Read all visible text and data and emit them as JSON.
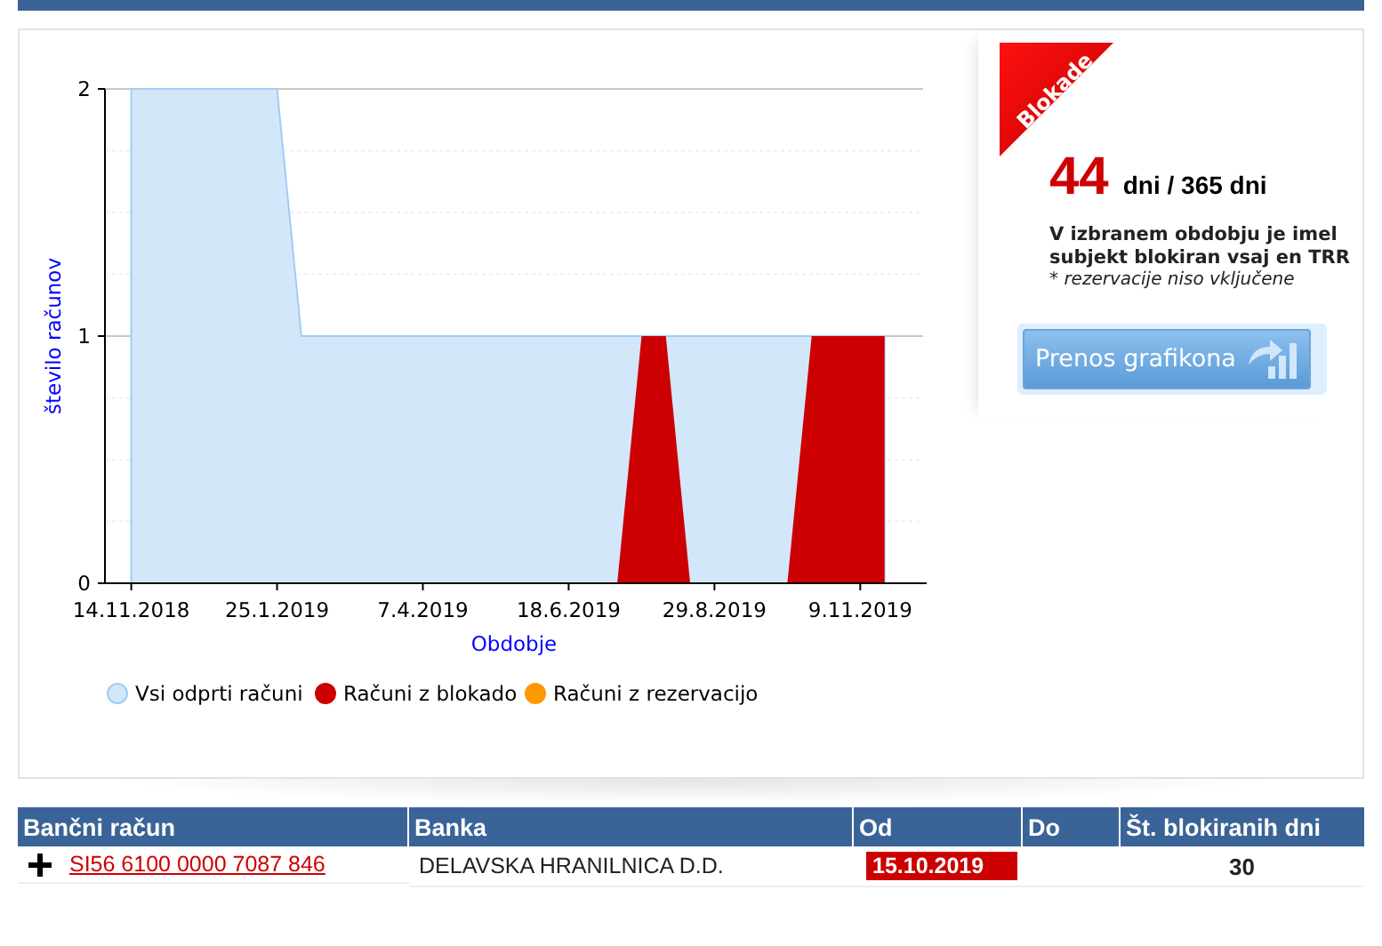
{
  "chart": {
    "chart_data": {
      "type": "area",
      "xlabel": "Obdobje",
      "ylabel": "število računov",
      "categories": [
        "14.11.2018",
        null,
        null,
        null,
        null,
        null,
        "25.1.2019",
        null,
        null,
        null,
        null,
        null,
        "7.4.2019",
        null,
        null,
        null,
        null,
        null,
        "18.6.2019",
        null,
        null,
        null,
        null,
        null,
        "29.8.2019",
        null,
        null,
        null,
        null,
        null,
        "9.11.2019",
        null
      ],
      "series": [
        {
          "name": "Vsi odprti računi",
          "color": "#d3e7fb",
          "values": [
            2,
            2,
            2,
            2,
            2,
            2,
            2,
            1,
            1,
            1,
            1,
            1,
            1,
            1,
            1,
            1,
            1,
            1,
            1,
            1,
            1,
            1,
            1,
            1,
            1,
            1,
            1,
            1,
            1,
            1,
            1,
            1
          ]
        },
        {
          "name": "Računi z blokado",
          "color": "#cc0000",
          "values": [
            0,
            0,
            0,
            0,
            0,
            0,
            0,
            0,
            0,
            0,
            0,
            0,
            0,
            0,
            0,
            0,
            0,
            0,
            0,
            0,
            0,
            1,
            1,
            0,
            0,
            0,
            0,
            0,
            1,
            1,
            1,
            1
          ]
        },
        {
          "name": "Računi z rezervacijo",
          "color": "#ff9900",
          "values": [
            null,
            null,
            null,
            null,
            null,
            null,
            null,
            null,
            null,
            null,
            null,
            null,
            null,
            null,
            null,
            null,
            null,
            null,
            null,
            null,
            null,
            null,
            null,
            null,
            null,
            null,
            null,
            null,
            null,
            null,
            null,
            null
          ]
        }
      ],
      "legend": true,
      "ylim": [
        0,
        2
      ],
      "yticks": [
        0,
        1,
        2
      ]
    }
  },
  "summary": {
    "ribbon": "Blokade",
    "days": "44",
    "days_suffix": "dni / 365 dni",
    "description": "V izbranem obdobju je imel subjekt blokiran vsaj en TRR",
    "note": "* *rezervacije niso vključene*",
    "button": "Prenos grafikona"
  },
  "table": {
    "columns": [
      "Bančni račun",
      "Banka",
      "Od",
      "Do",
      "Št. blokiranih dni"
    ],
    "rows": [
      {
        "account": "SI56 6100 0000 7087 846",
        "bank": "DELAVSKA HRANILNICA D.D.",
        "from": "15.10.2019",
        "blocked": true,
        "days": "30"
      }
    ]
  }
}
